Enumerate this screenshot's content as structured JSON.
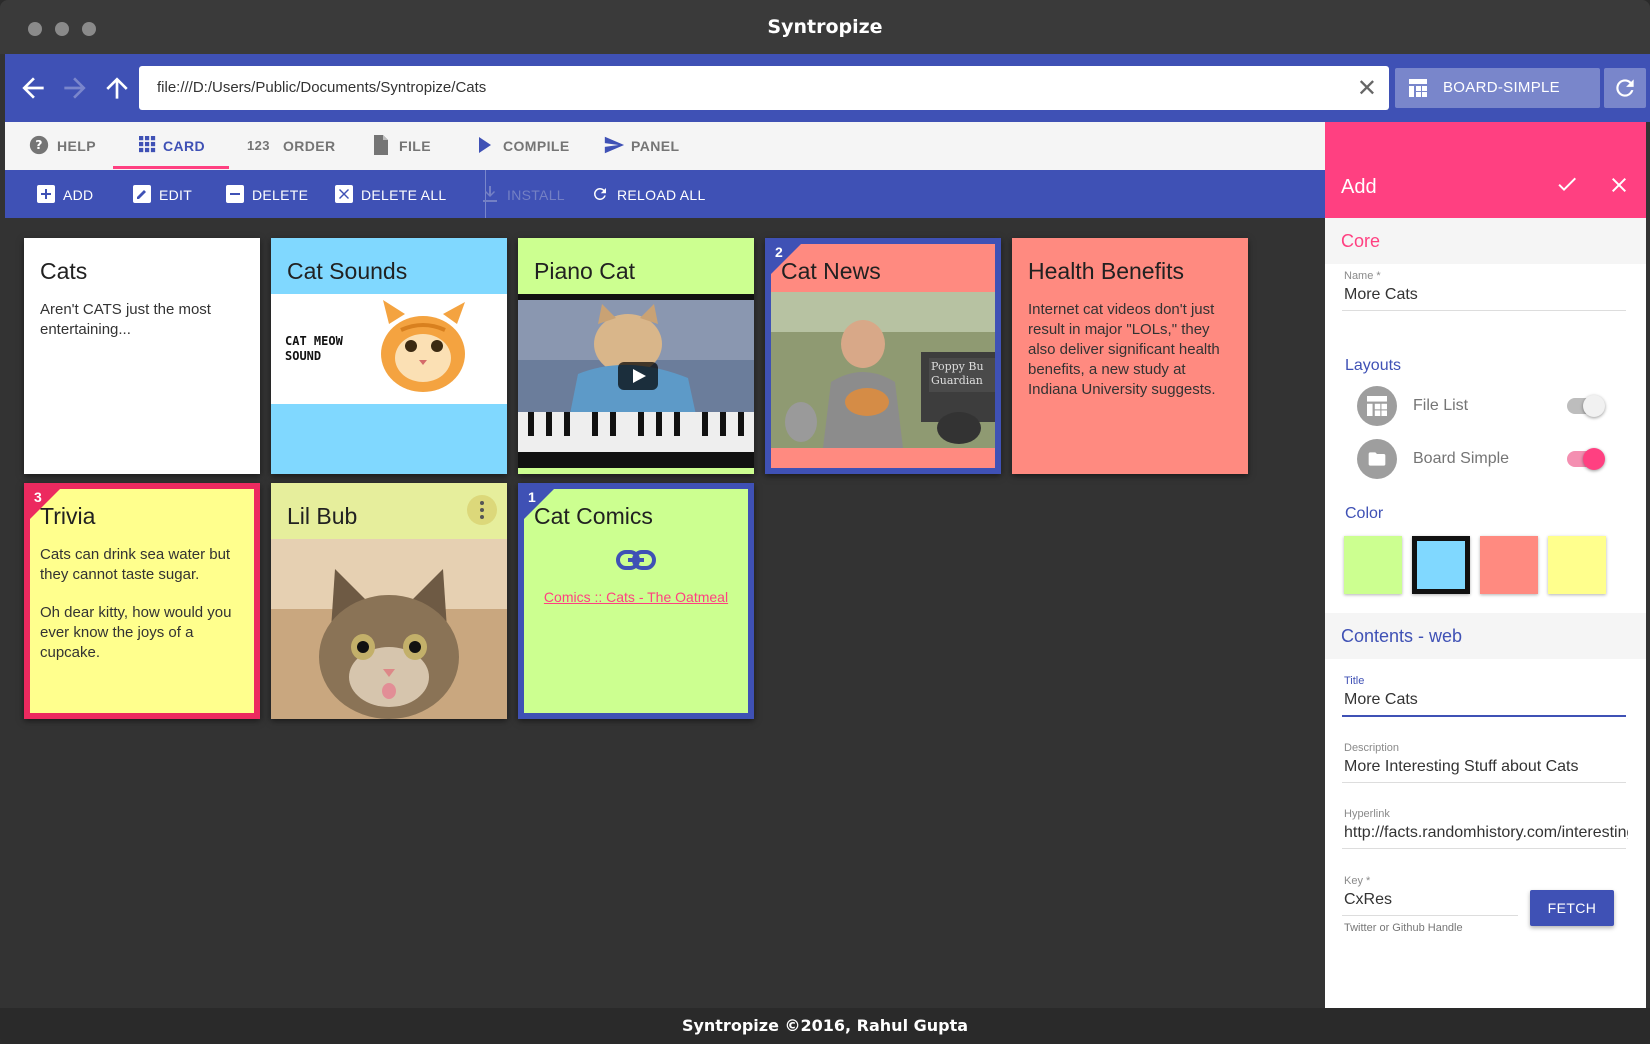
{
  "window": {
    "title": "Syntropize"
  },
  "addressbar": {
    "url": "file:///D:/Users/Public/Documents/Syntropize/Cats",
    "layout_label": "BOARD-SIMPLE"
  },
  "tabs": [
    {
      "label": "HELP",
      "icon": "help-icon"
    },
    {
      "label": "CARD",
      "icon": "grid-icon",
      "active": true
    },
    {
      "label": "ORDER",
      "icon": "123-icon"
    },
    {
      "label": "FILE",
      "icon": "file-icon"
    },
    {
      "label": "COMPILE",
      "icon": "play-icon"
    },
    {
      "label": "PANEL",
      "icon": "send-icon"
    }
  ],
  "actions": [
    {
      "label": "ADD",
      "icon": "plus-box-icon"
    },
    {
      "label": "EDIT",
      "icon": "pencil-box-icon"
    },
    {
      "label": "DELETE",
      "icon": "minus-box-icon"
    },
    {
      "label": "DELETE ALL",
      "icon": "close-box-icon"
    },
    {
      "label": "INSTALL",
      "icon": "download-icon",
      "disabled": true
    },
    {
      "label": "RELOAD ALL",
      "icon": "reload-icon"
    }
  ],
  "cards": {
    "cats": {
      "title": "Cats",
      "body": "Aren't CATS just the most entertaining..."
    },
    "cat_sounds": {
      "title": "Cat Sounds",
      "image_caption": "CAT MEOW SOUND"
    },
    "piano_cat": {
      "title": "Piano Cat"
    },
    "cat_news": {
      "title": "Cat News",
      "order": "2",
      "sign_text": "Poppy Bu Guardian"
    },
    "health": {
      "title": "Health Benefits",
      "body": "Internet cat videos don't just result in major \"LOLs,\" they also deliver significant health benefits, a new study at Indiana University suggests."
    },
    "trivia": {
      "title": "Trivia",
      "order": "3",
      "body1": "Cats can drink sea water but they cannot taste sugar.",
      "body2": "Oh dear kitty, how would you ever know the joys of a cupcake."
    },
    "lil_bub": {
      "title": "Lil Bub"
    },
    "cat_comics": {
      "title": "Cat Comics",
      "order": "1",
      "link": "Comics :: Cats - The Oatmeal"
    }
  },
  "panel": {
    "title": "Add",
    "core_label": "Core",
    "name_label": "Name *",
    "name_value": "More Cats",
    "layouts_label": "Layouts",
    "layouts": [
      {
        "name": "File List",
        "enabled": false
      },
      {
        "name": "Board Simple",
        "enabled": true
      }
    ],
    "color_label": "Color",
    "colors": [
      "#ccff90",
      "#80d8ff",
      "#ff8a80",
      "#ffff8d"
    ],
    "selected_color": "#80d8ff",
    "contents_label": "Contents",
    "contents_sep": " - ",
    "contents_type": "web",
    "title_label": "Title",
    "title_value": "More Cats",
    "description_label": "Description",
    "description_value": "More Interesting Stuff about Cats",
    "hyperlink_label": "Hyperlink",
    "hyperlink_value": "http://facts.randomhistory.com/interesting-facts-about-cats.html",
    "key_label": "Key *",
    "key_value": "CxRes",
    "key_hint": "Twitter or Github Handle",
    "fetch_label": "FETCH"
  },
  "footer": {
    "text": "Syntropize ©2016, Rahul Gupta"
  },
  "colors": {
    "primary": "#3f51b5",
    "accent": "#ff4081",
    "card_blue": "#80d8ff",
    "card_green": "#ccff90",
    "card_red": "#ff8a80",
    "card_yellow": "#ffff8d",
    "card_olive": "#e6ee9c"
  }
}
